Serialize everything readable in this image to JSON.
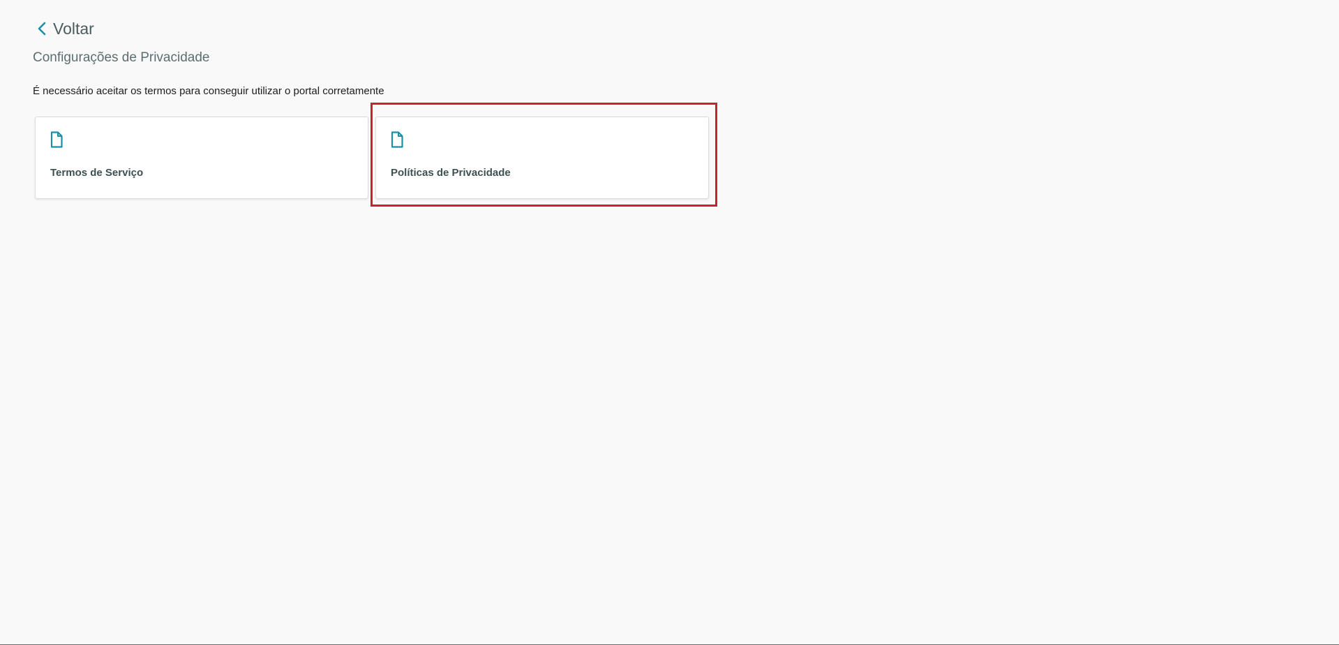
{
  "header": {
    "back_label": "Voltar",
    "title": "Configurações de Privacidade"
  },
  "notice": "É necessário aceitar os termos para conseguir utilizar o portal corretamente",
  "cards": [
    {
      "label": "Termos de Serviço",
      "icon": "document-icon"
    },
    {
      "label": "Políticas de Privacidade",
      "icon": "document-icon"
    }
  ],
  "colors": {
    "accent": "#1a8fa6",
    "highlight": "#cc2030",
    "background": "#f9f9f9"
  }
}
